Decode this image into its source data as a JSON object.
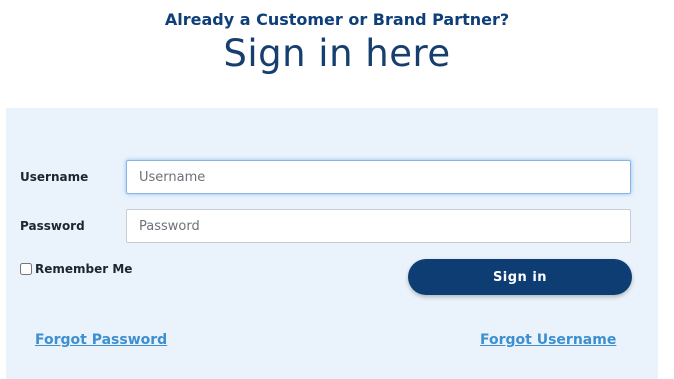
{
  "header": {
    "subtitle": "Already a Customer or Brand Partner?",
    "title": "Sign in here"
  },
  "form": {
    "username_label": "Username",
    "username_placeholder": "Username",
    "username_value": "",
    "password_label": "Password",
    "password_placeholder": "Password",
    "password_value": "",
    "remember_label": "Remember Me",
    "remember_checked": false,
    "signin_label": "Sign in"
  },
  "links": {
    "forgot_password": "Forgot Password",
    "forgot_username": "Forgot Username"
  },
  "colors": {
    "brand_navy": "#0d3d72",
    "link_blue": "#3d8fcf",
    "panel_bg": "#eaf3fb"
  }
}
